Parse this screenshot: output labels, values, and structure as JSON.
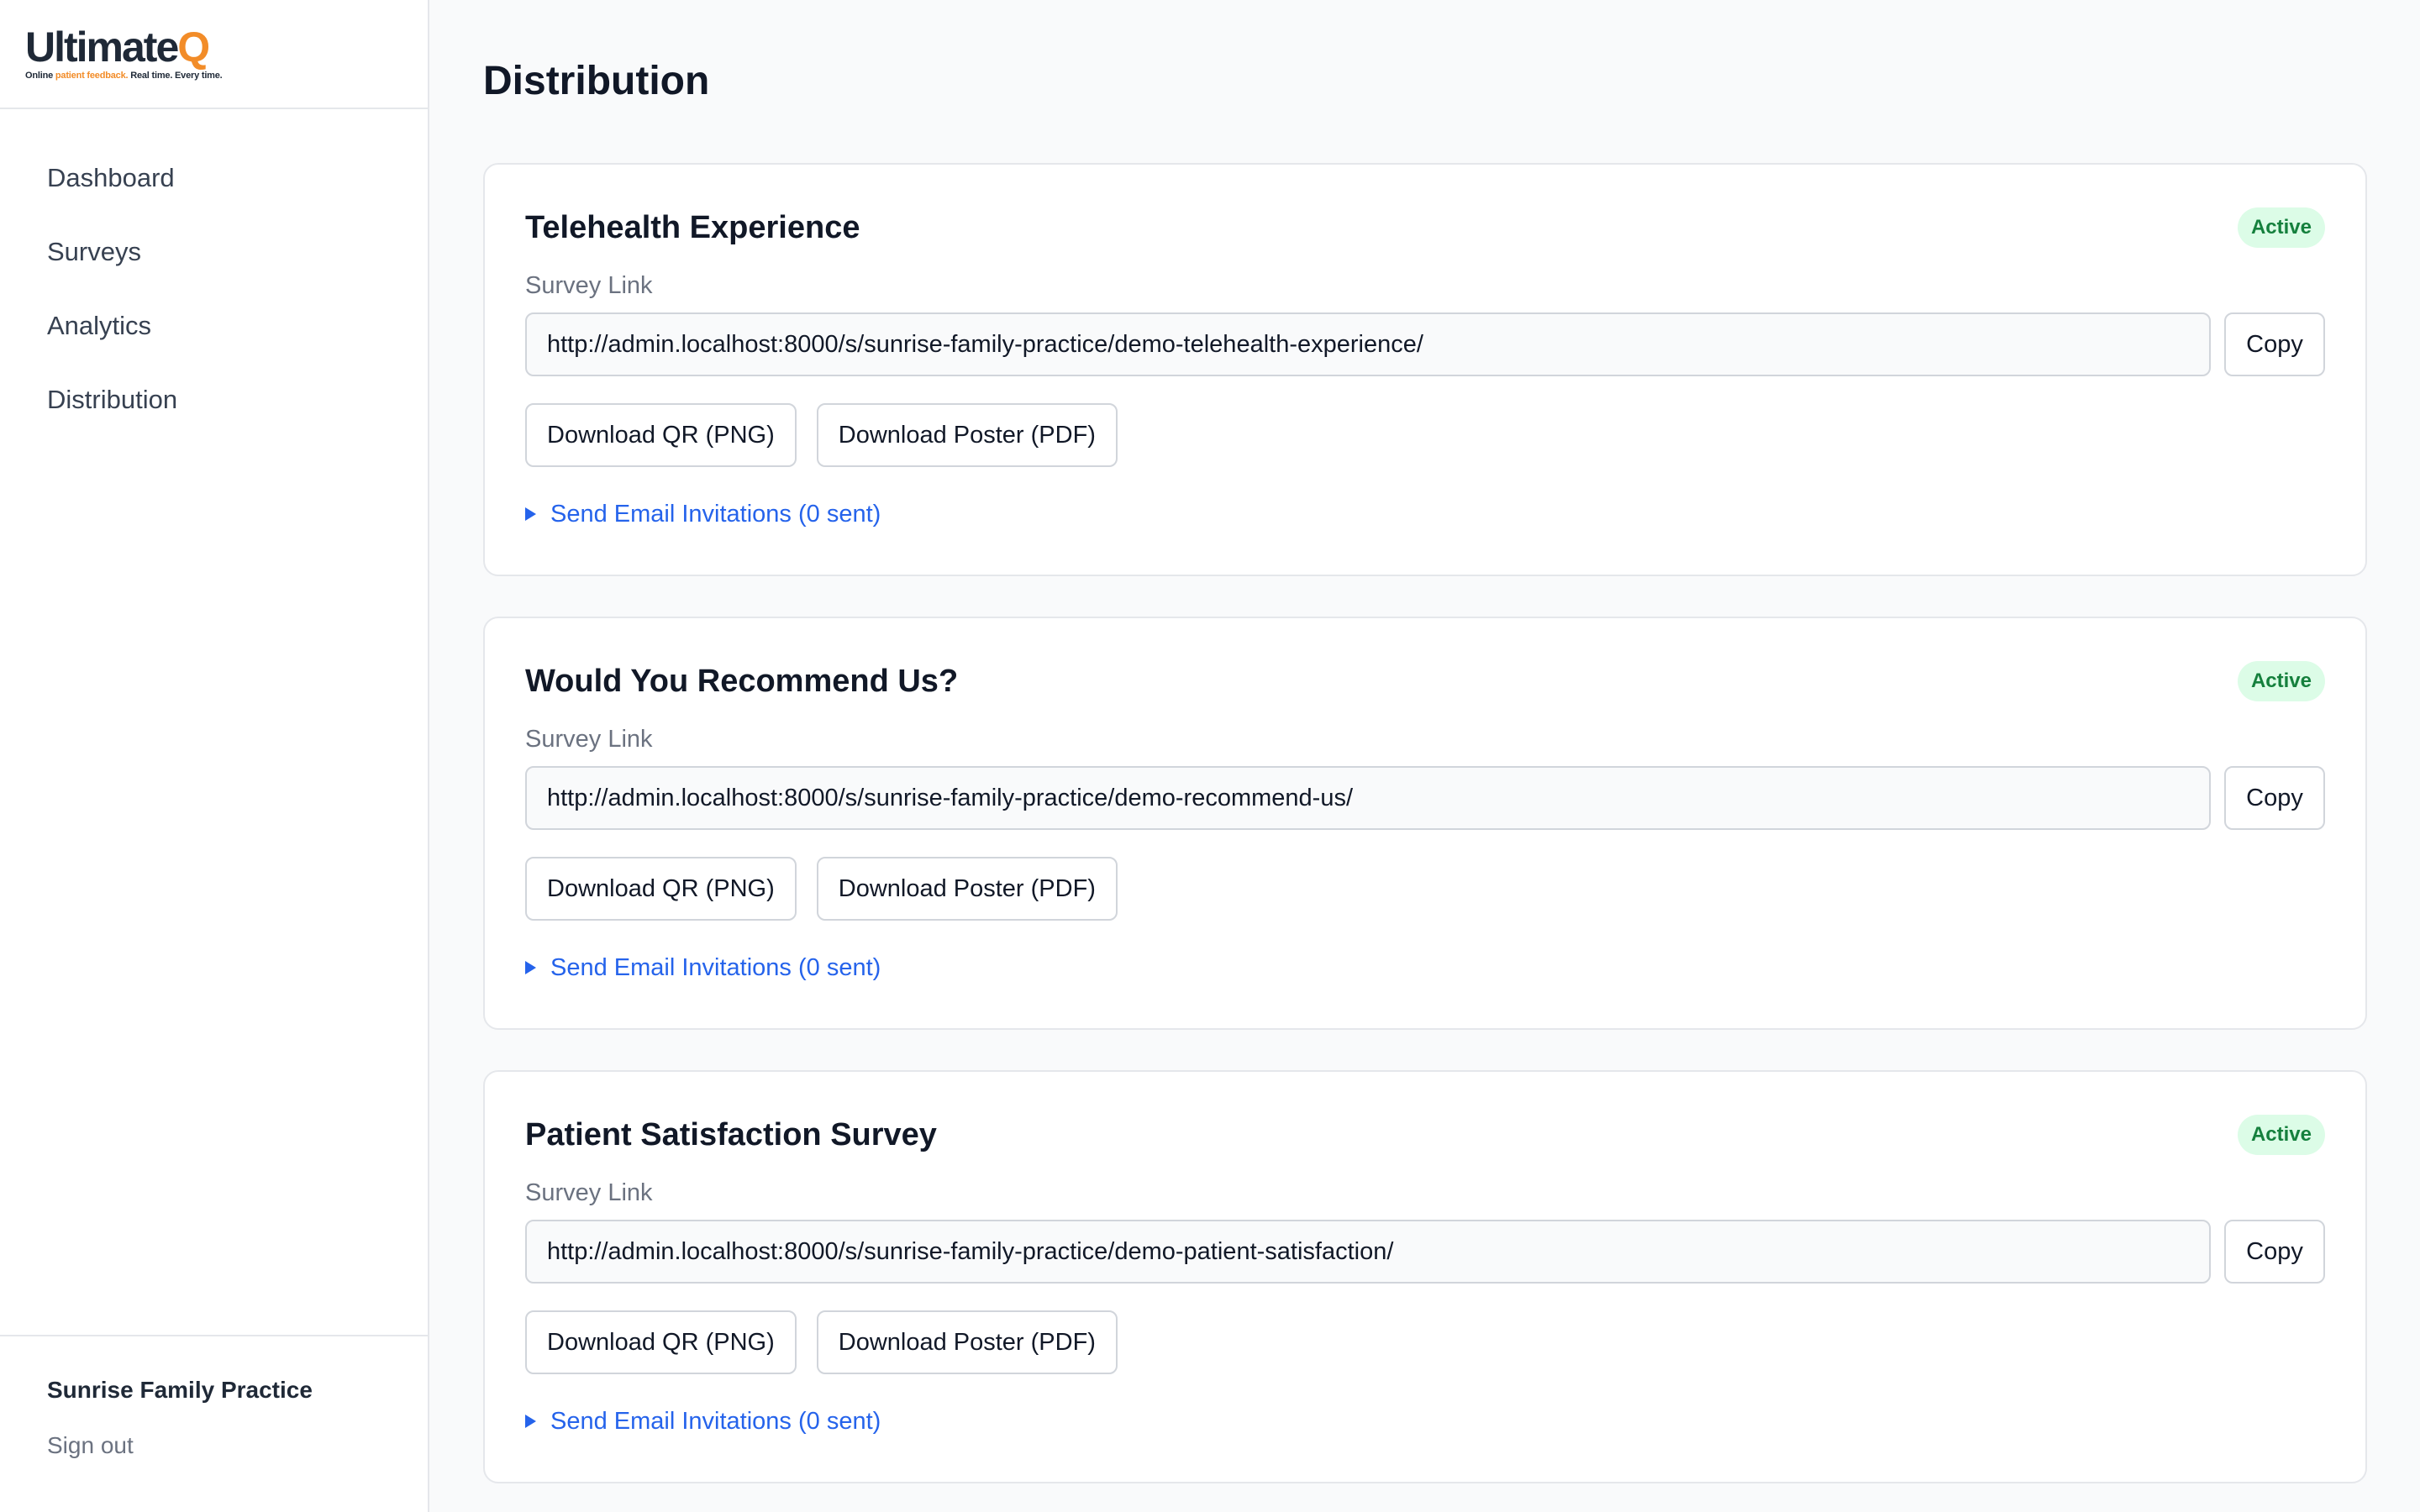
{
  "brand": {
    "name_main": "Ultimate",
    "name_accent": "Q",
    "tagline_1": "Online ",
    "tagline_2": "patient feedback.",
    "tagline_3": " Real time. Every time.",
    "accent_color": "#f28c28"
  },
  "nav": {
    "items": [
      {
        "label": "Dashboard"
      },
      {
        "label": "Surveys"
      },
      {
        "label": "Analytics"
      },
      {
        "label": "Distribution"
      }
    ]
  },
  "footer": {
    "org_name": "Sunrise Family Practice",
    "signout_label": "Sign out"
  },
  "page": {
    "title": "Distribution"
  },
  "surveys": [
    {
      "title": "Telehealth Experience",
      "status": "Active",
      "link_label": "Survey Link",
      "link": "http://admin.localhost:8000/s/sunrise-family-practice/demo-telehealth-experience/",
      "copy_label": "Copy",
      "qr_label": "Download QR (PNG)",
      "poster_label": "Download Poster (PDF)",
      "email_label": "Send Email Invitations (0 sent)"
    },
    {
      "title": "Would You Recommend Us?",
      "status": "Active",
      "link_label": "Survey Link",
      "link": "http://admin.localhost:8000/s/sunrise-family-practice/demo-recommend-us/",
      "copy_label": "Copy",
      "qr_label": "Download QR (PNG)",
      "poster_label": "Download Poster (PDF)",
      "email_label": "Send Email Invitations (0 sent)"
    },
    {
      "title": "Patient Satisfaction Survey",
      "status": "Active",
      "link_label": "Survey Link",
      "link": "http://admin.localhost:8000/s/sunrise-family-practice/demo-patient-satisfaction/",
      "copy_label": "Copy",
      "qr_label": "Download QR (PNG)",
      "poster_label": "Download Poster (PDF)",
      "email_label": "Send Email Invitations (0 sent)"
    }
  ]
}
